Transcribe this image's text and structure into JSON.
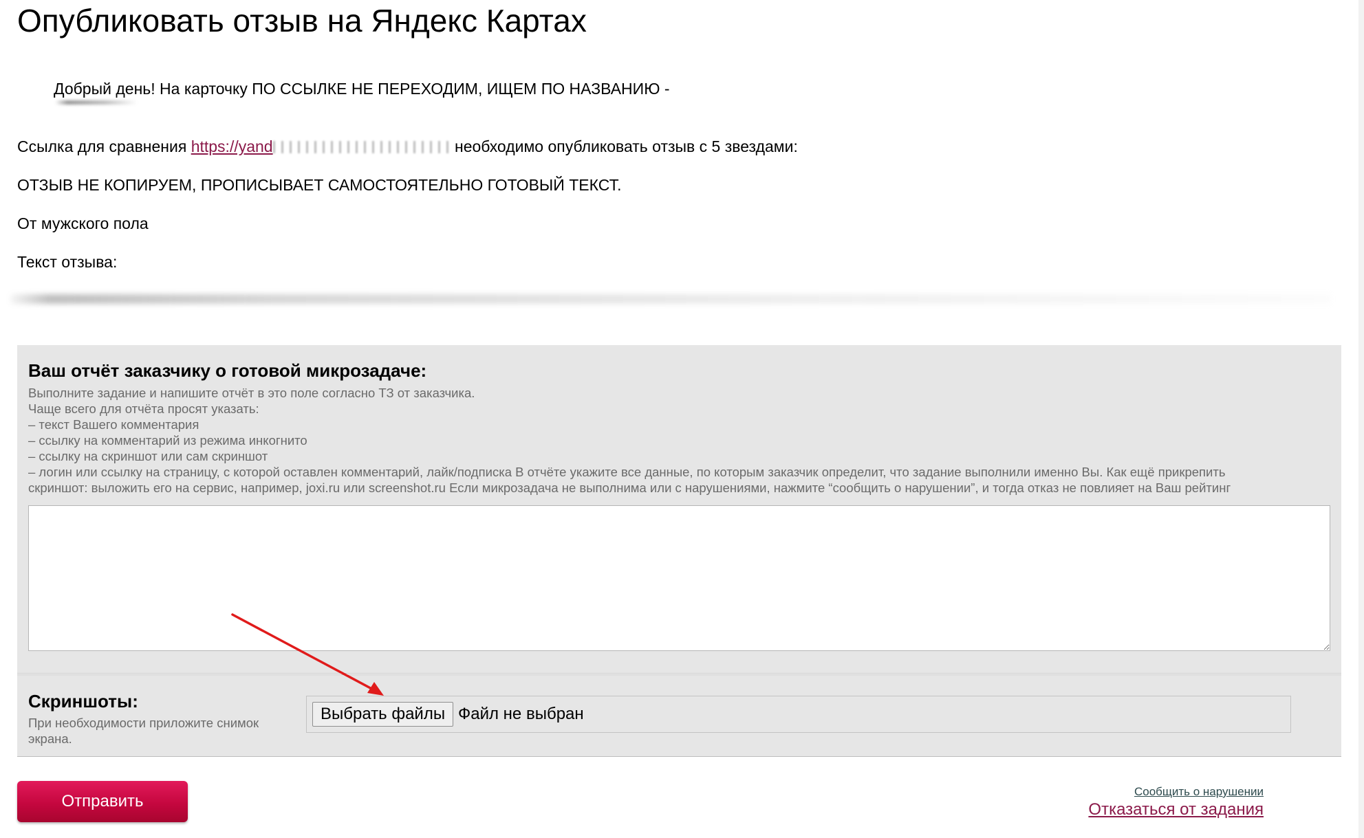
{
  "page": {
    "title": "Опубликовать отзыв на Яндекс Картах"
  },
  "task": {
    "greeting": "Добрый день! На карточку ПО ССЫЛКЕ НЕ ПЕРЕХОДИМ, ИЩЕМ ПО НАЗВАНИЮ -",
    "compare_prefix": "Ссылка для сравнения",
    "compare_link": "https://yand",
    "compare_suffix": "необходимо опубликовать отзыв с 5 звездами:",
    "no_copy": "ОТЗЫВ НЕ КОПИРУЕМ, ПРОПИСЫВАЕТ САМОСТОЯТЕЛЬНО ГОТОВЫЙ ТЕКСТ.",
    "gender": "От мужского пола",
    "review_text_label": "Текст отзыва:"
  },
  "report": {
    "title": "Ваш отчёт заказчику о готовой микрозадаче:",
    "desc_lines": [
      "Выполните задание и напишите отчёт в это поле согласно ТЗ от заказчика.",
      "Чаще всего для отчёта просят указать:",
      "– текст Вашего комментария",
      "– ссылку на комментарий из режима инкогнито",
      "– ссылку на скриншот или сам скриншот",
      "– логин или ссылку на страницу, с которой оставлен комментарий, лайк/подписка В отчёте укажите все данные, по которым заказчик определит, что задание выполнили именно Вы. Как ещё прикрепить",
      "скриншот: выложить его на сервис, например, joxi.ru или screenshot.ru Если микрозадача не выполнима или с нарушениями, нажмите “сообщить о нарушении”, и тогда отказ не повлияет на Ваш рейтинг"
    ],
    "textarea_value": ""
  },
  "screenshots": {
    "title": "Скриншоты:",
    "hint": "При необходимости приложите снимок экрана.",
    "choose_button": "Выбрать файлы",
    "status": "Файл не выбран"
  },
  "actions": {
    "submit": "Отправить",
    "report_violation": "Сообщить о нарушении",
    "refuse_task": "Отказаться от задания"
  },
  "colors": {
    "link": "#8b1a4a",
    "submit_button": "#c5073f",
    "panel_bg": "#e6e6e6",
    "annotation_arrow": "#e01b1b"
  }
}
